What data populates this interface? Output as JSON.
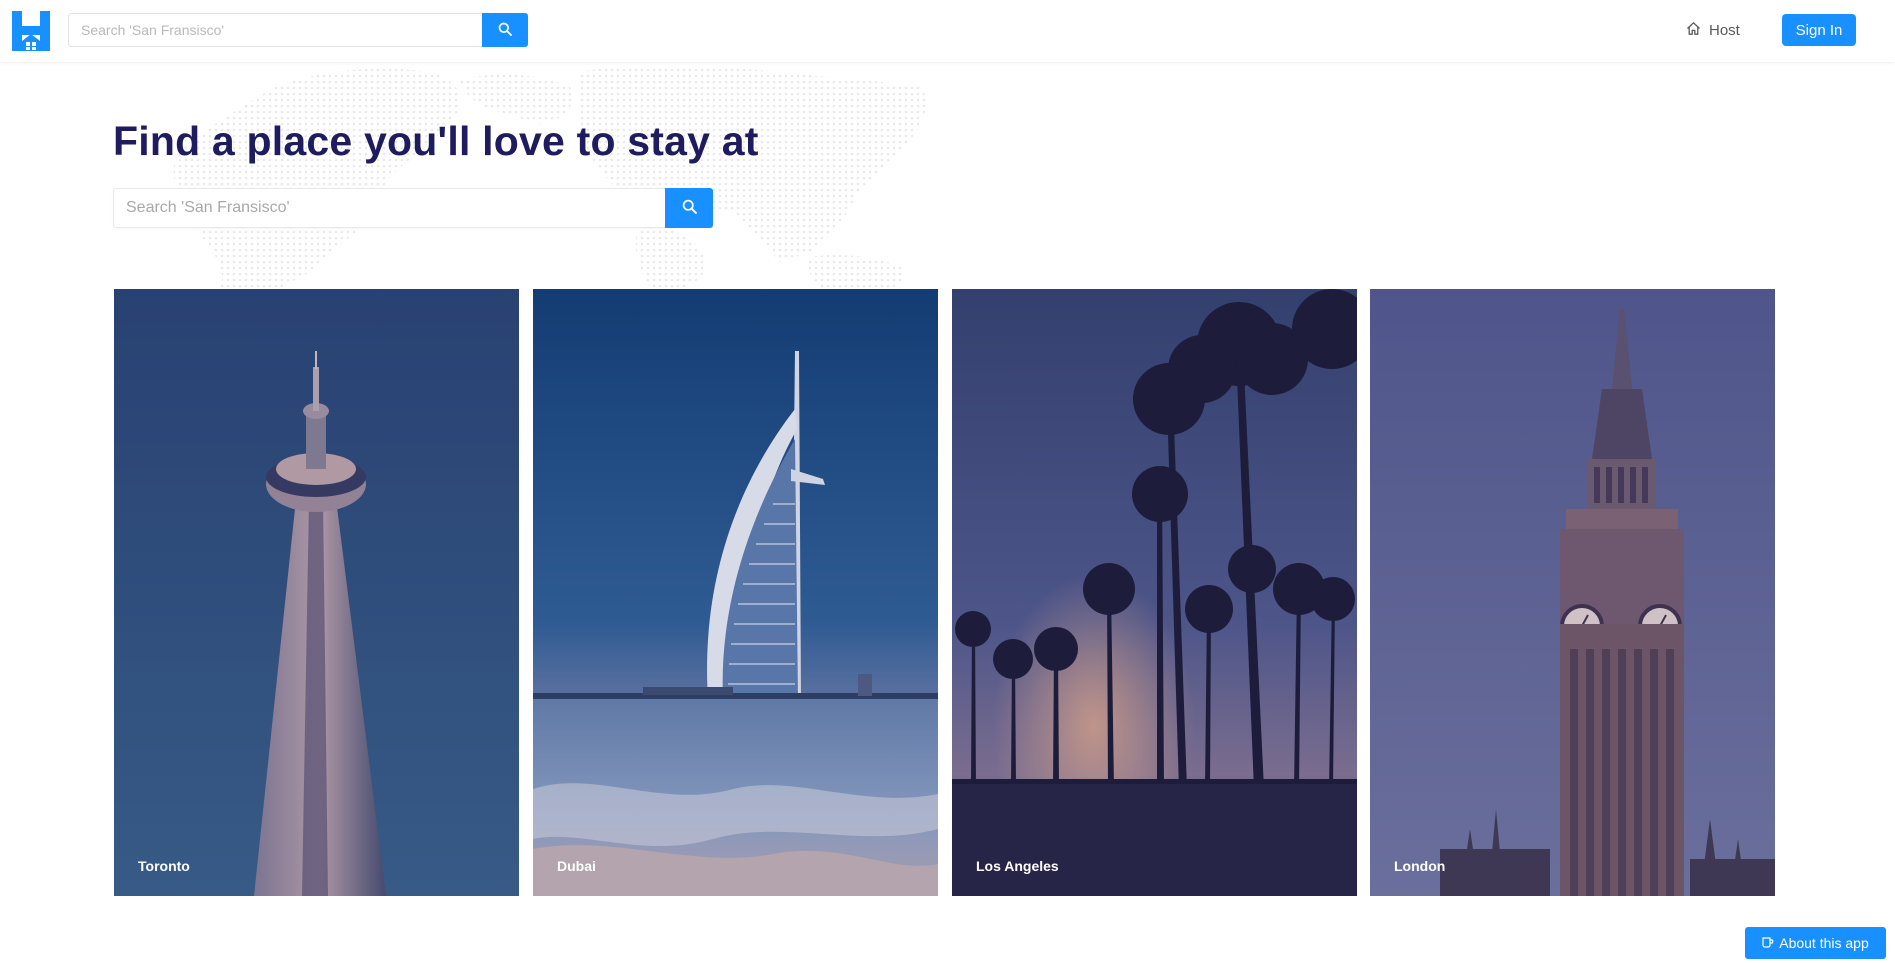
{
  "header": {
    "search_placeholder": "Search 'San Fransisco'",
    "host_label": "Host",
    "signin_label": "Sign In"
  },
  "hero": {
    "title": "Find a place you'll love to stay at",
    "search_placeholder": "Search 'San Fransisco'"
  },
  "cities": [
    {
      "name": "Toronto"
    },
    {
      "name": "Dubai"
    },
    {
      "name": "Los Angeles"
    },
    {
      "name": "London"
    }
  ],
  "about_label": "About this app",
  "colors": {
    "accent": "#1890ff",
    "title": "#1e1b5e"
  },
  "icons": [
    "logo-icon",
    "search-icon",
    "home-icon",
    "coffee-icon"
  ]
}
